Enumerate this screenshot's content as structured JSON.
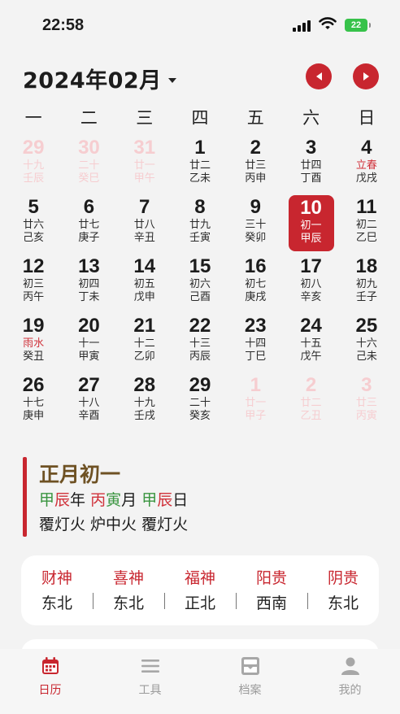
{
  "status": {
    "time": "22:58",
    "battery": "22"
  },
  "header": {
    "month": "2024年02月"
  },
  "weekdays": [
    "一",
    "二",
    "三",
    "四",
    "五",
    "六",
    "日"
  ],
  "days": [
    {
      "n": "29",
      "l1": "十九",
      "l2": "壬辰",
      "dim": true
    },
    {
      "n": "30",
      "l1": "二十",
      "l2": "癸巳",
      "dim": true
    },
    {
      "n": "31",
      "l1": "廿一",
      "l2": "甲午",
      "dim": true
    },
    {
      "n": "1",
      "l1": "廿二",
      "l2": "乙未"
    },
    {
      "n": "2",
      "l1": "廿三",
      "l2": "丙申"
    },
    {
      "n": "3",
      "l1": "廿四",
      "l2": "丁酉"
    },
    {
      "n": "4",
      "l1": "立春",
      "l2": "戊戌",
      "term": true
    },
    {
      "n": "5",
      "l1": "廿六",
      "l2": "己亥"
    },
    {
      "n": "6",
      "l1": "廿七",
      "l2": "庚子"
    },
    {
      "n": "7",
      "l1": "廿八",
      "l2": "辛丑"
    },
    {
      "n": "8",
      "l1": "廿九",
      "l2": "壬寅"
    },
    {
      "n": "9",
      "l1": "三十",
      "l2": "癸卯"
    },
    {
      "n": "10",
      "l1": "初一",
      "l2": "甲辰",
      "sel": true
    },
    {
      "n": "11",
      "l1": "初二",
      "l2": "乙巳"
    },
    {
      "n": "12",
      "l1": "初三",
      "l2": "丙午"
    },
    {
      "n": "13",
      "l1": "初四",
      "l2": "丁未"
    },
    {
      "n": "14",
      "l1": "初五",
      "l2": "戊申"
    },
    {
      "n": "15",
      "l1": "初六",
      "l2": "己酉"
    },
    {
      "n": "16",
      "l1": "初七",
      "l2": "庚戌"
    },
    {
      "n": "17",
      "l1": "初八",
      "l2": "辛亥"
    },
    {
      "n": "18",
      "l1": "初九",
      "l2": "壬子"
    },
    {
      "n": "19",
      "l1": "雨水",
      "l2": "癸丑",
      "term": true
    },
    {
      "n": "20",
      "l1": "十一",
      "l2": "甲寅"
    },
    {
      "n": "21",
      "l1": "十二",
      "l2": "乙卯"
    },
    {
      "n": "22",
      "l1": "十三",
      "l2": "丙辰"
    },
    {
      "n": "23",
      "l1": "十四",
      "l2": "丁巳"
    },
    {
      "n": "24",
      "l1": "十五",
      "l2": "戊午"
    },
    {
      "n": "25",
      "l1": "十六",
      "l2": "己未"
    },
    {
      "n": "26",
      "l1": "十七",
      "l2": "庚申"
    },
    {
      "n": "27",
      "l1": "十八",
      "l2": "辛酉"
    },
    {
      "n": "28",
      "l1": "十九",
      "l2": "壬戌"
    },
    {
      "n": "29",
      "l1": "二十",
      "l2": "癸亥"
    },
    {
      "n": "1",
      "l1": "廿一",
      "l2": "甲子",
      "dim": true
    },
    {
      "n": "2",
      "l1": "廿二",
      "l2": "乙丑",
      "dim": true
    },
    {
      "n": "3",
      "l1": "廿三",
      "l2": "丙寅",
      "dim": true
    }
  ],
  "info": {
    "lunar_date": "正月初一",
    "year_stem": "甲",
    "year_branch": "辰",
    "year_suffix": "年",
    "month_stem": "丙",
    "month_branch": "寅",
    "month_suffix": "月",
    "day_stem": "甲",
    "day_branch": "辰",
    "day_suffix": "日",
    "nayin": "覆灯火 炉中火 覆灯火"
  },
  "gods": [
    {
      "name": "财神",
      "dir": "东北"
    },
    {
      "name": "喜神",
      "dir": "东北"
    },
    {
      "name": "福神",
      "dir": "正北"
    },
    {
      "name": "阳贵",
      "dir": "西南"
    },
    {
      "name": "阴贵",
      "dir": "东北"
    }
  ],
  "tabs": [
    {
      "label": "日历",
      "icon": "calendar-icon"
    },
    {
      "label": "工具",
      "icon": "menu-icon"
    },
    {
      "label": "档案",
      "icon": "archive-icon"
    },
    {
      "label": "我的",
      "icon": "person-icon"
    }
  ],
  "colors": {
    "accent": "#c8262f",
    "stem_green": "#3a9540",
    "lunar_brown": "#6e5123",
    "dim_pink": "#f6cdd0"
  }
}
